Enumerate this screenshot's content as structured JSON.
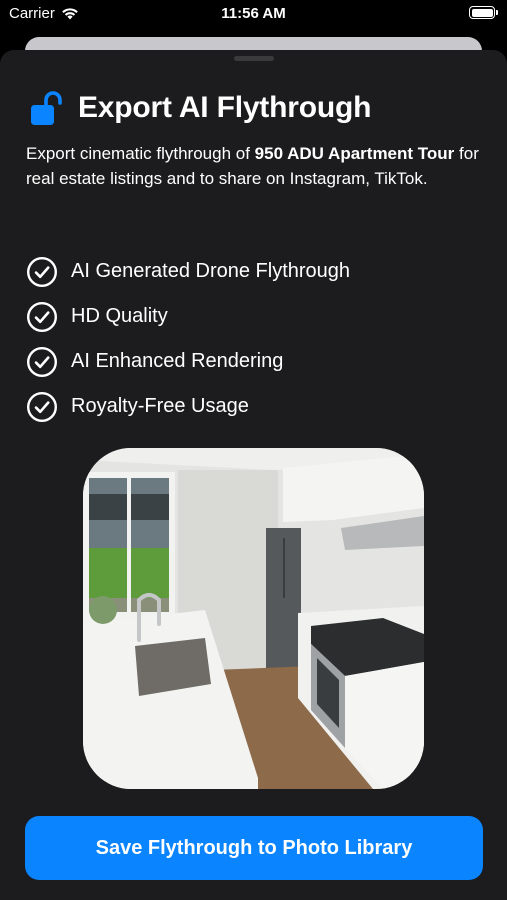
{
  "status_bar": {
    "carrier": "Carrier",
    "time": "11:56 AM",
    "wifi_icon": "wifi-icon",
    "battery_icon": "battery-icon"
  },
  "sheet": {
    "title": "Export AI Flythrough",
    "title_icon": "unlocked-lock-icon",
    "description": {
      "prefix": "Export cinematic flythrough of ",
      "project_name": "950 ADU Apartment Tour",
      "suffix": " for real estate listings and to share on Instagram, TikTok."
    },
    "features": [
      {
        "label": "AI Generated Drone Flythrough",
        "icon": "checkmark-circle-icon"
      },
      {
        "label": "HD Quality",
        "icon": "checkmark-circle-icon"
      },
      {
        "label": "AI Enhanced Rendering",
        "icon": "checkmark-circle-icon"
      },
      {
        "label": "Royalty-Free Usage",
        "icon": "checkmark-circle-icon"
      }
    ],
    "preview_image": "kitchen-preview-image",
    "primary_button": "Save Flythrough to Photo Library"
  },
  "colors": {
    "background": "#000000",
    "sheet": "#1c1c1e",
    "accent": "#0a84ff",
    "text": "#ffffff"
  }
}
